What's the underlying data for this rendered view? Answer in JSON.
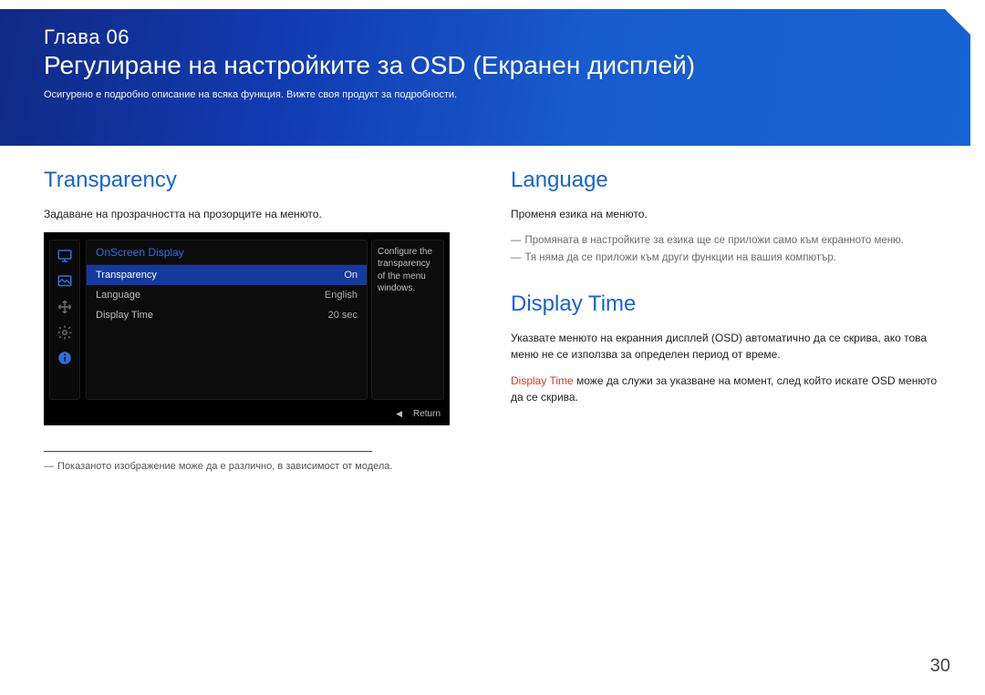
{
  "banner": {
    "chapter": "Глава 06",
    "title": "Регулиране на настройките за OSD (Екранен дисплей)",
    "subtitle": "Осигурено е подробно описание на всяка функция. Вижте своя продукт за подробности."
  },
  "left": {
    "heading": "Transparency",
    "desc": "Задаване на прозрачността на прозорците на менюто.",
    "osd": {
      "panel_title": "OnScreen Display",
      "rows": [
        {
          "label": "Transparency",
          "value": "On",
          "selected": true
        },
        {
          "label": "Language",
          "value": "English",
          "selected": false
        },
        {
          "label": "Display Time",
          "value": "20 sec",
          "selected": false
        }
      ],
      "tip_lines": [
        "Configure the",
        "transparency",
        "of the menu",
        "windows."
      ],
      "footer_return": "Return"
    },
    "footnote": "Показаното изображение може да е различно, в зависимост от модела."
  },
  "right": {
    "language": {
      "heading": "Language",
      "desc": "Променя езика на менюто.",
      "notes": [
        "Промяната в настройките за езика ще се приложи само към екранното меню.",
        "Тя няма да се приложи към други функции на вашия компютър."
      ]
    },
    "display_time": {
      "heading": "Display Time",
      "desc": "Указвате менюто на екранния дисплей (OSD) автоматично да се скрива, ако това меню не се използва за определен период от време.",
      "highlight_label": "Display Time",
      "highlight_rest": " може да служи за указване на момент, след който искате OSD менюто да се скрива."
    }
  },
  "page_number": "30"
}
